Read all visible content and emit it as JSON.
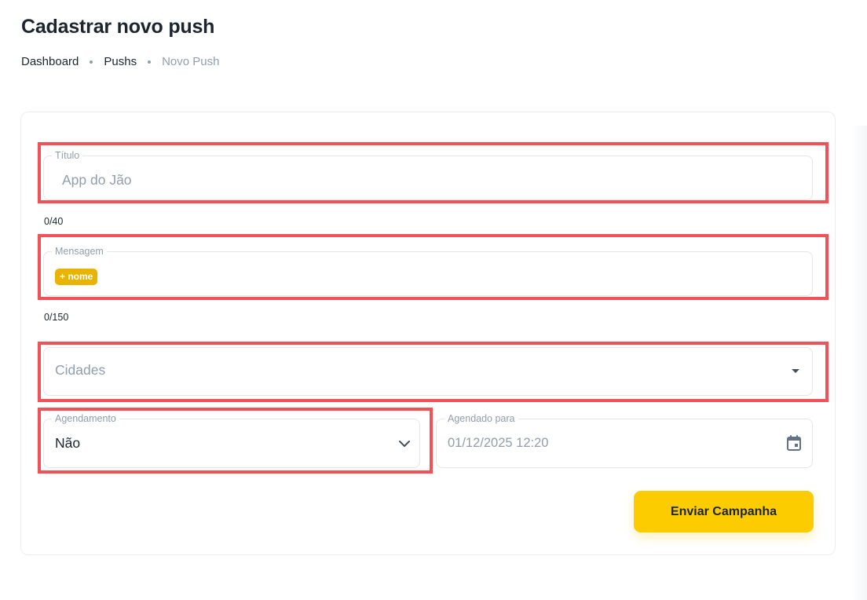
{
  "header": {
    "title": "Cadastrar novo push",
    "breadcrumbs": [
      "Dashboard",
      "Pushs",
      "Novo Push"
    ]
  },
  "form": {
    "titulo": {
      "label": "Título",
      "value": "",
      "placeholder": "App do Jão",
      "counter": "0/40"
    },
    "mensagem": {
      "label": "Mensagem",
      "chip": "+ nome",
      "counter": "0/150"
    },
    "cidades": {
      "placeholder": "Cidades"
    },
    "agendamento": {
      "label": "Agendamento",
      "value": "Não"
    },
    "agendado_para": {
      "label": "Agendado para",
      "value": "01/12/2025 12:20"
    },
    "submit_label": "Enviar Campanha"
  },
  "colors": {
    "accent": "#fccb00",
    "chip": "#e8b400",
    "highlight": "#f25157",
    "muted_text": "#919eab",
    "text": "#1c252e"
  },
  "icons": [
    "caret-down-icon",
    "chevron-down-icon",
    "calendar-icon"
  ]
}
